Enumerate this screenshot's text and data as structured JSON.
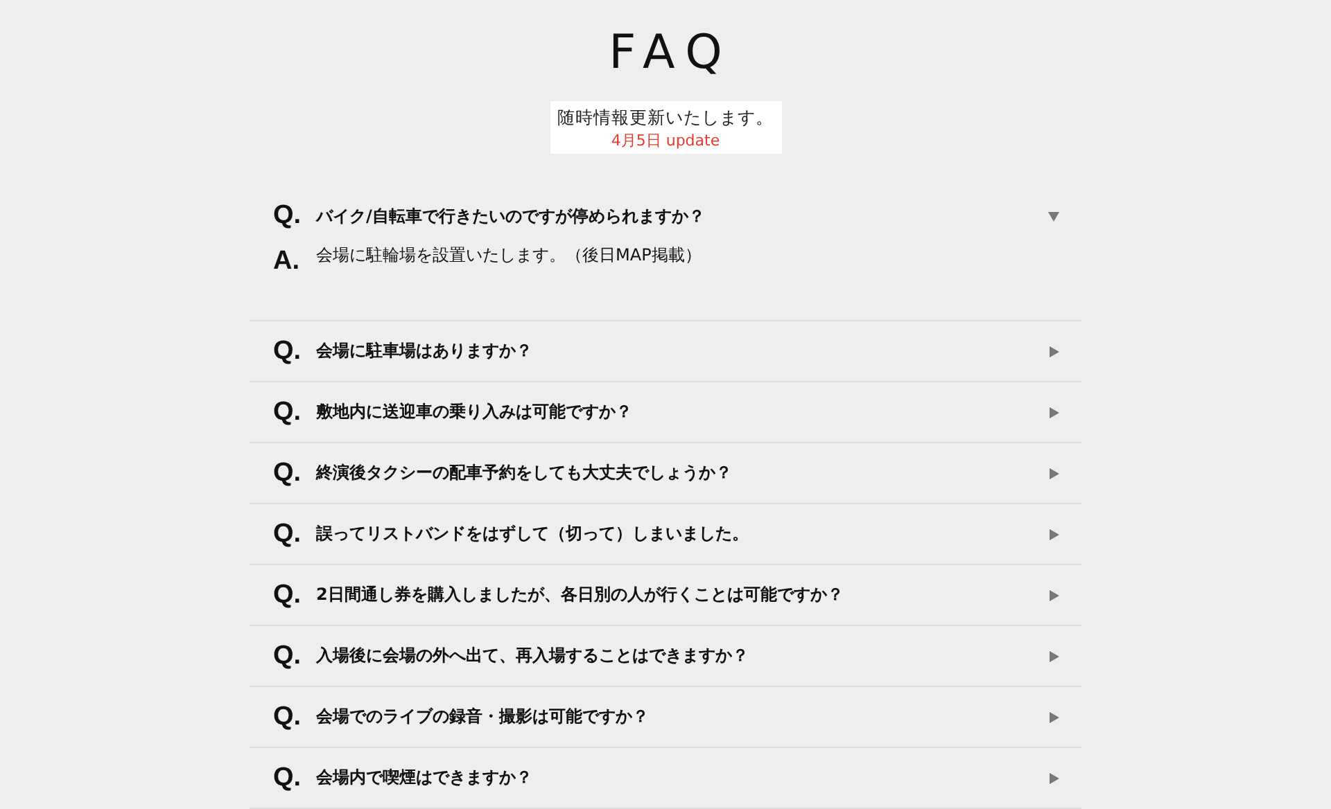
{
  "title": "FAQ",
  "notice": {
    "text": "随時情報更新いたします。",
    "update": "4月5日 update"
  },
  "faqs": [
    {
      "marker": "Q.",
      "question": "バイク/自転車で行きたいのですが停められますか？",
      "expanded": true,
      "answer_marker": "A.",
      "answer": "会場に駐輪場を設置いたします。（後日MAP掲載）"
    },
    {
      "marker": "Q.",
      "question": "会場に駐車場はありますか？",
      "expanded": false
    },
    {
      "marker": "Q.",
      "question": "敷地内に送迎車の乗り入みは可能ですか？",
      "expanded": false
    },
    {
      "marker": "Q.",
      "question": "終演後タクシーの配車予約をしても大丈夫でしょうか？",
      "expanded": false
    },
    {
      "marker": "Q.",
      "question": "誤ってリストバンドをはずして（切って）しまいました。",
      "expanded": false
    },
    {
      "marker": "Q.",
      "question": "2日間通し券を購入しましたが、各日別の人が行くことは可能ですか？",
      "expanded": false
    },
    {
      "marker": "Q.",
      "question": "入場後に会場の外へ出て、再入場することはできますか？",
      "expanded": false
    },
    {
      "marker": "Q.",
      "question": "会場でのライブの録音・撮影は可能ですか？",
      "expanded": false
    },
    {
      "marker": "Q.",
      "question": "会場内で喫煙はできますか？",
      "expanded": false
    }
  ]
}
